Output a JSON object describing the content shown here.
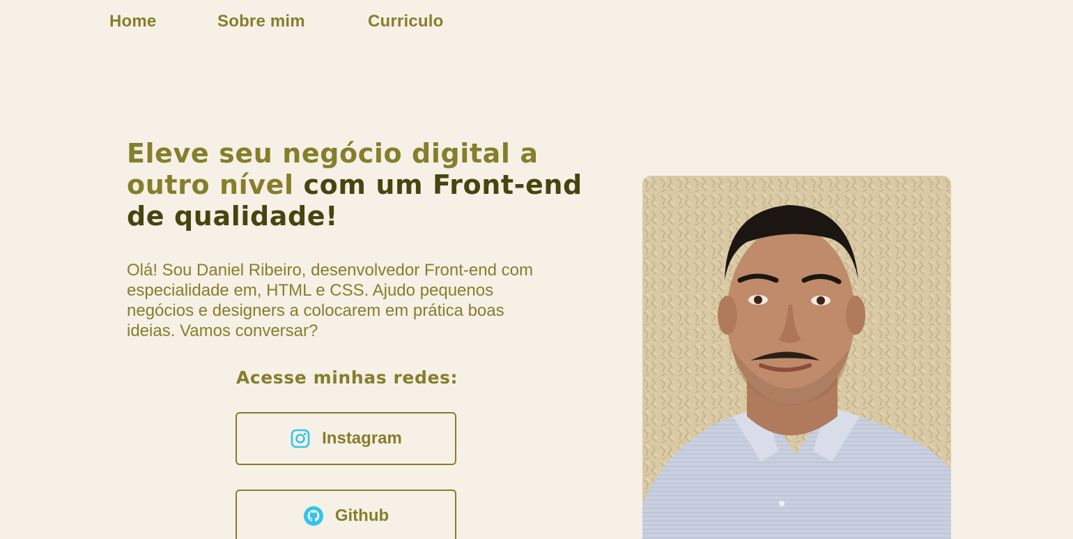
{
  "nav": {
    "home": "Home",
    "about": "Sobre mim",
    "cv": "Curriculo"
  },
  "hero": {
    "headline_accent": "Eleve seu negócio digital a outro nível",
    "headline_rest": " com um Front-end de qualidade!",
    "intro": "Olá! Sou Daniel Ribeiro, desenvolvedor Front-end com especialidade em, HTML e CSS. Ajudo pequenos negócios e designers a colocarem em prática boas ideias. Vamos conversar?",
    "networks_title": "Acesse minhas redes:"
  },
  "social": [
    {
      "label": "Instagram",
      "icon": "instagram-icon"
    },
    {
      "label": "Github",
      "icon": "github-icon"
    }
  ],
  "colors": {
    "background": "#f6f0e6",
    "accent": "#857e2b",
    "dark": "#45450f",
    "icon": "#2fc6ec"
  }
}
